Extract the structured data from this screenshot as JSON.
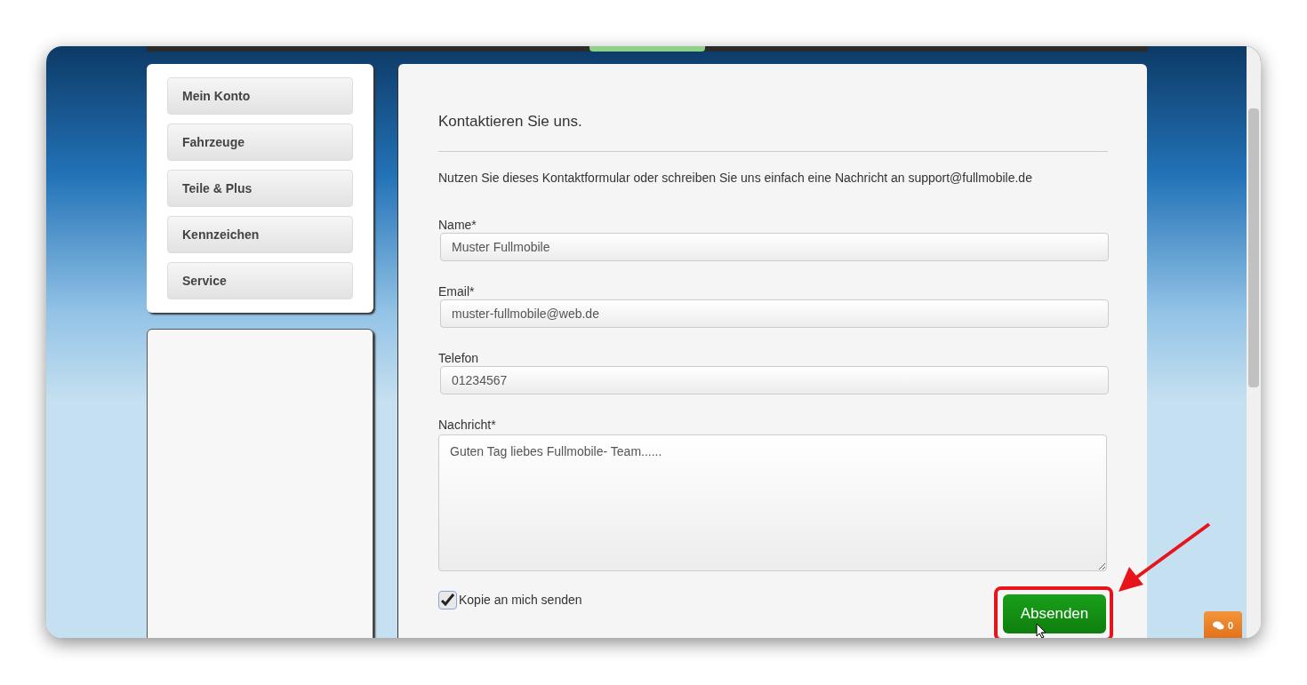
{
  "sidebar": {
    "items": [
      {
        "label": "Mein Konto"
      },
      {
        "label": "Fahrzeuge"
      },
      {
        "label": "Teile & Plus"
      },
      {
        "label": "Kennzeichen"
      },
      {
        "label": "Service"
      }
    ]
  },
  "form": {
    "title": "Kontaktieren Sie uns.",
    "intro": "Nutzen Sie dieses Kontaktformular oder schreiben Sie uns einfach eine Nachricht an support@fullmobile.de",
    "fields": [
      {
        "kind": "input",
        "label": "Name*",
        "value": "Muster Fullmobile"
      },
      {
        "kind": "input",
        "label": "Email*",
        "value": "muster-fullmobile@web.de"
      },
      {
        "kind": "input",
        "label": "Telefon",
        "value": "01234567"
      },
      {
        "kind": "textarea",
        "label": "Nachricht*",
        "value": "Guten Tag liebes Fullmobile- Team......"
      }
    ],
    "copy": {
      "label": "Kopie an mich senden",
      "checked": true
    },
    "submit": "Absenden"
  },
  "chat_badge": {
    "count": "0"
  }
}
